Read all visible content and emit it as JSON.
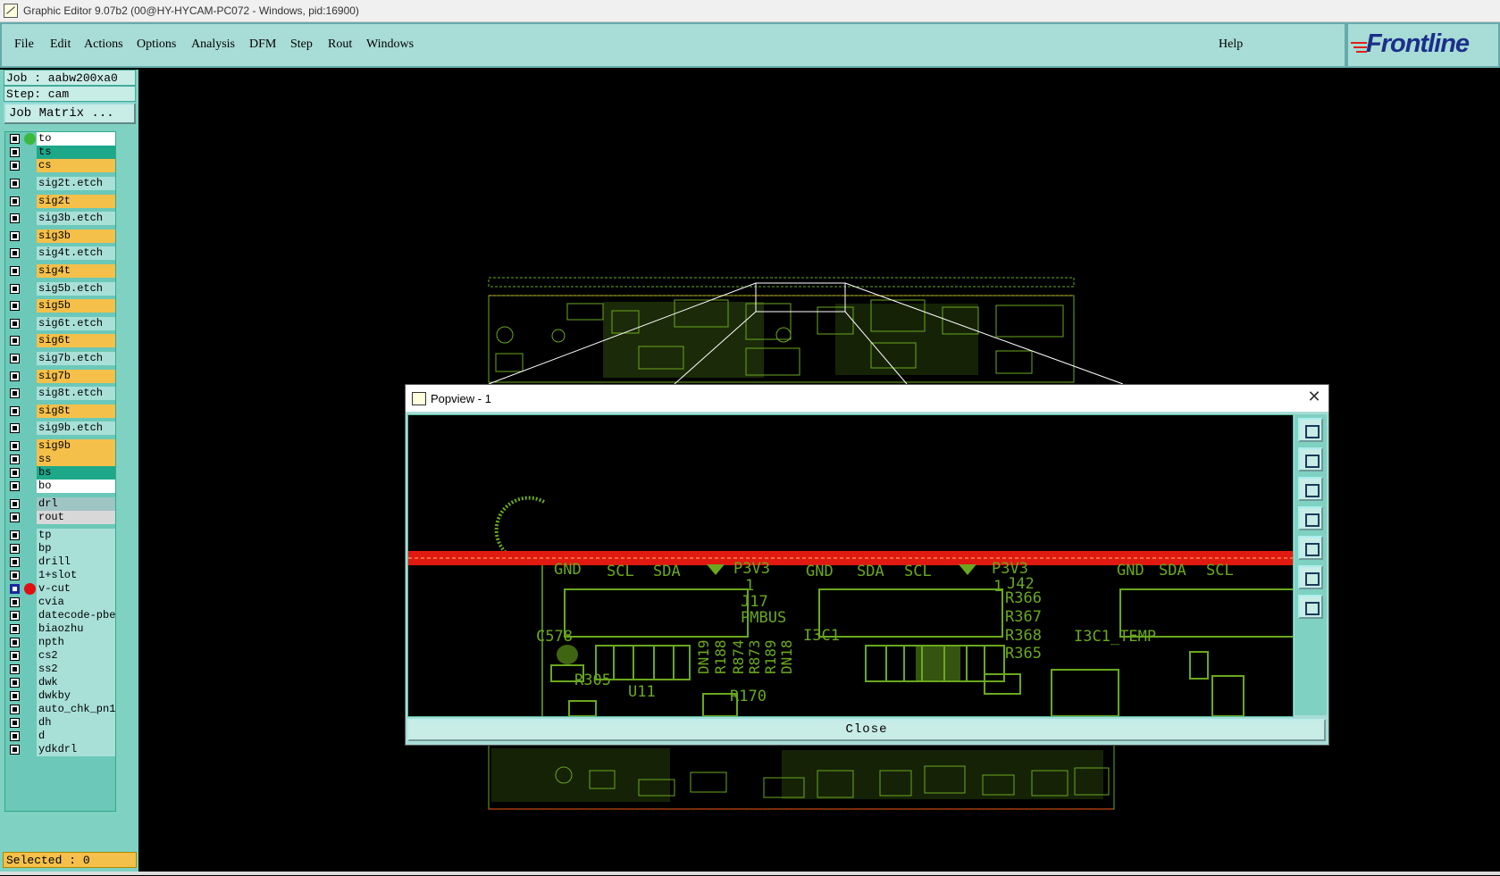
{
  "window": {
    "title": "Graphic Editor 9.07b2 (00@HY-HYCAM-PC072 - Windows, pid:16900)"
  },
  "menu": {
    "items": [
      "File",
      "Edit",
      "Actions",
      "Options",
      "Analysis",
      "DFM",
      "Step",
      "Rout",
      "Windows"
    ],
    "help": "Help",
    "logo": "Frontline"
  },
  "job": {
    "job_label": "Job : aabw200xa0",
    "step_label": "Step: cam",
    "matrix_button": "Job Matrix ..."
  },
  "layers": [
    {
      "name": "to",
      "color": "#ffffff",
      "dot": "#3cb83c"
    },
    {
      "name": "ts",
      "color": "#1ea88a",
      "dot": ""
    },
    {
      "name": "cs",
      "color": "#f5c04a",
      "dot": ""
    },
    {
      "name": "sig2t.etch",
      "color": "#a8e0d8",
      "dot": ""
    },
    {
      "name": "sig2t",
      "color": "#f5c04a",
      "dot": ""
    },
    {
      "name": "sig3b.etch",
      "color": "#a8e0d8",
      "dot": ""
    },
    {
      "name": "sig3b",
      "color": "#f5c04a",
      "dot": ""
    },
    {
      "name": "sig4t.etch",
      "color": "#a8e0d8",
      "dot": ""
    },
    {
      "name": "sig4t",
      "color": "#f5c04a",
      "dot": ""
    },
    {
      "name": "sig5b.etch",
      "color": "#a8e0d8",
      "dot": ""
    },
    {
      "name": "sig5b",
      "color": "#f5c04a",
      "dot": ""
    },
    {
      "name": "sig6t.etch",
      "color": "#a8e0d8",
      "dot": ""
    },
    {
      "name": "sig6t",
      "color": "#f5c04a",
      "dot": ""
    },
    {
      "name": "sig7b.etch",
      "color": "#a8e0d8",
      "dot": ""
    },
    {
      "name": "sig7b",
      "color": "#f5c04a",
      "dot": ""
    },
    {
      "name": "sig8t.etch",
      "color": "#a8e0d8",
      "dot": ""
    },
    {
      "name": "sig8t",
      "color": "#f5c04a",
      "dot": ""
    },
    {
      "name": "sig9b.etch",
      "color": "#a8e0d8",
      "dot": ""
    },
    {
      "name": "sig9b",
      "color": "#f5c04a",
      "dot": ""
    },
    {
      "name": "ss",
      "color": "#f5c04a",
      "dot": ""
    },
    {
      "name": "bs",
      "color": "#1ea88a",
      "dot": ""
    },
    {
      "name": "bo",
      "color": "#ffffff",
      "dot": ""
    },
    {
      "name": "drl",
      "color": "#9fc4c4",
      "dot": ""
    },
    {
      "name": "rout",
      "color": "#d8d8d8",
      "dot": ""
    },
    {
      "name": "tp",
      "color": "#a8e0d8",
      "dot": ""
    },
    {
      "name": "bp",
      "color": "#a8e0d8",
      "dot": ""
    },
    {
      "name": "drill",
      "color": "#a8e0d8",
      "dot": ""
    },
    {
      "name": "1+slot",
      "color": "#a8e0d8",
      "dot": ""
    },
    {
      "name": "v-cut",
      "color": "#a8e0d8",
      "dot": "#e01010",
      "selected": true
    },
    {
      "name": "cvia",
      "color": "#a8e0d8",
      "dot": ""
    },
    {
      "name": "datecode-pbe",
      "color": "#a8e0d8",
      "dot": ""
    },
    {
      "name": "biaozhu",
      "color": "#a8e0d8",
      "dot": ""
    },
    {
      "name": "npth",
      "color": "#a8e0d8",
      "dot": ""
    },
    {
      "name": "cs2",
      "color": "#a8e0d8",
      "dot": ""
    },
    {
      "name": "ss2",
      "color": "#a8e0d8",
      "dot": ""
    },
    {
      "name": "dwk",
      "color": "#a8e0d8",
      "dot": ""
    },
    {
      "name": "dwkby",
      "color": "#a8e0d8",
      "dot": ""
    },
    {
      "name": "auto_chk_pn1",
      "color": "#a8e0d8",
      "dot": ""
    },
    {
      "name": "dh",
      "color": "#a8e0d8",
      "dot": ""
    },
    {
      "name": "d",
      "color": "#a8e0d8",
      "dot": ""
    },
    {
      "name": "ydkdrl",
      "color": "#a8e0d8",
      "dot": ""
    }
  ],
  "status": {
    "selected": "Selected : 0"
  },
  "popview": {
    "title": "Popview - 1",
    "close_label": "Close",
    "labels": {
      "gnd1": "GND",
      "scl1": "SCL",
      "sda1": "SDA",
      "p3v3a": "P3V3",
      "j17": "J17",
      "pmbus": "PMBUS",
      "gnd2": "GND",
      "sda2": "SDA",
      "scl2": "SCL",
      "p3v3b": "P3V3",
      "j42": "J42",
      "r366": "R366",
      "r367": "R367",
      "r368": "R368",
      "r365": "R365",
      "gnd3": "GND",
      "sda3": "SDA",
      "scl3": "SCL",
      "c578": "C578",
      "r305": "R305",
      "u11": "U11",
      "i3c1": "I3C1",
      "i3c1temp": "I3C1_TEMP",
      "dn19": "DN19",
      "r188": "R188",
      "r874": "R874",
      "r873": "R873",
      "r189": "R189",
      "dn18": "DN18",
      "r170": "R170",
      "one_a": "1",
      "one_b": "1"
    }
  },
  "colors": {
    "pcb_green": "#6aa81e",
    "route_red": "#e01a10",
    "panel": "#7fd1c2"
  }
}
